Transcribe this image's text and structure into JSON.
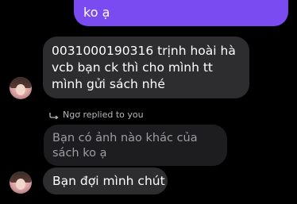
{
  "messages": {
    "outgoing_tail": "ko ạ",
    "incoming_1": "0031000190316 trịnh hoài hà vcb bạn ck thì cho mình tt mình gửi sách nhé",
    "reply_label": "Ngơ replied to you",
    "quoted": "Bạn có ảnh nào khác của sách ko ạ",
    "incoming_2": "Bạn đợi mình chút"
  },
  "colors": {
    "background": "#000000",
    "outgoing_bubble": "#7a4bf0",
    "incoming_bubble": "#2d2d2f",
    "quoted_bubble": "#1d1d1f"
  }
}
